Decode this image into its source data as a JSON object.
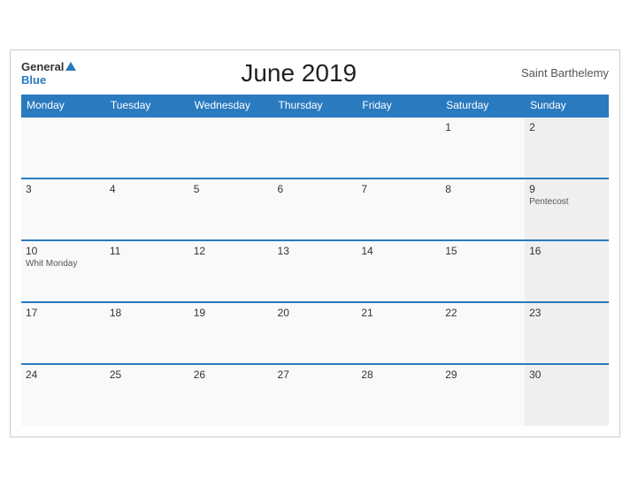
{
  "header": {
    "logo_general": "General",
    "logo_blue": "Blue",
    "title": "June 2019",
    "region": "Saint Barthelemy"
  },
  "weekdays": [
    "Monday",
    "Tuesday",
    "Wednesday",
    "Thursday",
    "Friday",
    "Saturday",
    "Sunday"
  ],
  "weeks": [
    [
      {
        "day": "",
        "holiday": ""
      },
      {
        "day": "",
        "holiday": ""
      },
      {
        "day": "",
        "holiday": ""
      },
      {
        "day": "",
        "holiday": ""
      },
      {
        "day": "",
        "holiday": ""
      },
      {
        "day": "1",
        "holiday": ""
      },
      {
        "day": "2",
        "holiday": ""
      }
    ],
    [
      {
        "day": "3",
        "holiday": ""
      },
      {
        "day": "4",
        "holiday": ""
      },
      {
        "day": "5",
        "holiday": ""
      },
      {
        "day": "6",
        "holiday": ""
      },
      {
        "day": "7",
        "holiday": ""
      },
      {
        "day": "8",
        "holiday": ""
      },
      {
        "day": "9",
        "holiday": "Pentecost"
      }
    ],
    [
      {
        "day": "10",
        "holiday": "Whit Monday"
      },
      {
        "day": "11",
        "holiday": ""
      },
      {
        "day": "12",
        "holiday": ""
      },
      {
        "day": "13",
        "holiday": ""
      },
      {
        "day": "14",
        "holiday": ""
      },
      {
        "day": "15",
        "holiday": ""
      },
      {
        "day": "16",
        "holiday": ""
      }
    ],
    [
      {
        "day": "17",
        "holiday": ""
      },
      {
        "day": "18",
        "holiday": ""
      },
      {
        "day": "19",
        "holiday": ""
      },
      {
        "day": "20",
        "holiday": ""
      },
      {
        "day": "21",
        "holiday": ""
      },
      {
        "day": "22",
        "holiday": ""
      },
      {
        "day": "23",
        "holiday": ""
      }
    ],
    [
      {
        "day": "24",
        "holiday": ""
      },
      {
        "day": "25",
        "holiday": ""
      },
      {
        "day": "26",
        "holiday": ""
      },
      {
        "day": "27",
        "holiday": ""
      },
      {
        "day": "28",
        "holiday": ""
      },
      {
        "day": "29",
        "holiday": ""
      },
      {
        "day": "30",
        "holiday": ""
      }
    ]
  ]
}
